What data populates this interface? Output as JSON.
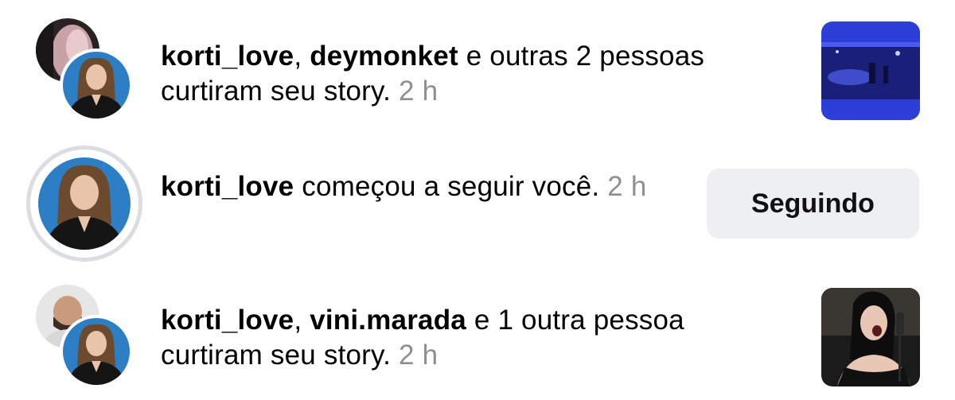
{
  "notifications": [
    {
      "users": [
        "korti_love",
        "deymonket"
      ],
      "separator": ", ",
      "action": " e outras 2 pessoas curtiram seu story.",
      "time": "2 h",
      "thumbnail_icon": "concert-photo"
    },
    {
      "users": [
        "korti_love"
      ],
      "action": " começou a seguir você.",
      "time": "2 h",
      "button_label": "Seguindo"
    },
    {
      "users": [
        "korti_love",
        "vini.marada"
      ],
      "separator": ", ",
      "action": " e 1 outra pessoa curtiram seu story.",
      "time": "2 h",
      "thumbnail_icon": "singer-photo"
    }
  ],
  "colors": {
    "timestamp": "#8e8e93",
    "button_bg": "#eeeff3",
    "story_ring": "#dcdde2"
  }
}
